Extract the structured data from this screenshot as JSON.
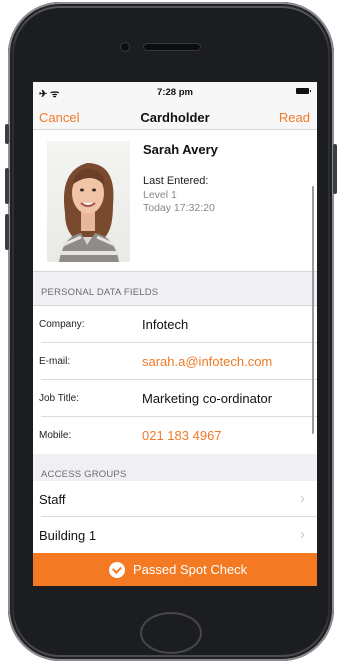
{
  "status_bar": {
    "time": "7:28 pm",
    "left_icons": "airplane-wifi-icons"
  },
  "nav": {
    "cancel": "Cancel",
    "title": "Cardholder",
    "read": "Read"
  },
  "profile": {
    "name": "Sarah Avery",
    "last_entered_label": "Last Entered:",
    "location": "Level 1",
    "time": "Today 17:32:20"
  },
  "personal": {
    "header": "PERSONAL DATA FIELDS",
    "rows": [
      {
        "label": "Company:",
        "value": "Infotech"
      },
      {
        "label": "E-mail:",
        "value": "sarah.a@infotech.com"
      },
      {
        "label": "Job Title:",
        "value": "Marketing co-ordinator"
      },
      {
        "label": "Mobile:",
        "value": "021 183 4967"
      }
    ]
  },
  "access": {
    "header": "ACCESS GROUPS",
    "items": [
      {
        "label": "Staff"
      },
      {
        "label": "Building 1"
      }
    ]
  },
  "footer": {
    "label": "Passed Spot Check",
    "icon": "check-circle-icon"
  },
  "colors": {
    "accent": "#f07a27",
    "footer_bg": "#f37a22"
  }
}
